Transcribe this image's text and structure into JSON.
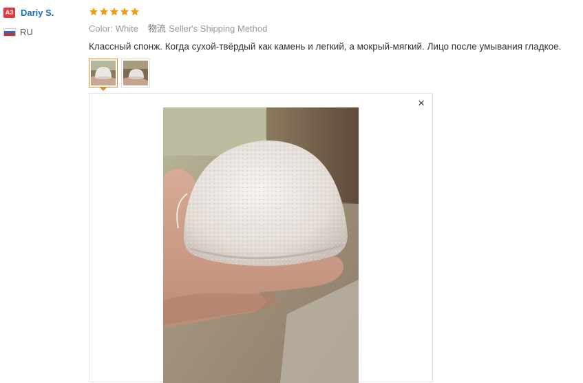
{
  "reviewer": {
    "badge": "A3",
    "name": "Dariy S.",
    "country_code": "RU",
    "flag_icon": "russia-flag-icon"
  },
  "review": {
    "rating": 5,
    "rating_max": 5,
    "star_color": "#f39c12",
    "color_label": "Color:",
    "color_value": "White",
    "shipping_label": "物流",
    "shipping_value": "Seller's Shipping Method",
    "text": "Классный спонж. Когда сухой-твёрдый как камень и легкий, а мокрый-мягкий. Лицо после умывания гладкое."
  },
  "gallery": {
    "thumbnail_count": 2,
    "active_index": 0,
    "close_label": "×",
    "accent_color": "#e58a1f"
  }
}
